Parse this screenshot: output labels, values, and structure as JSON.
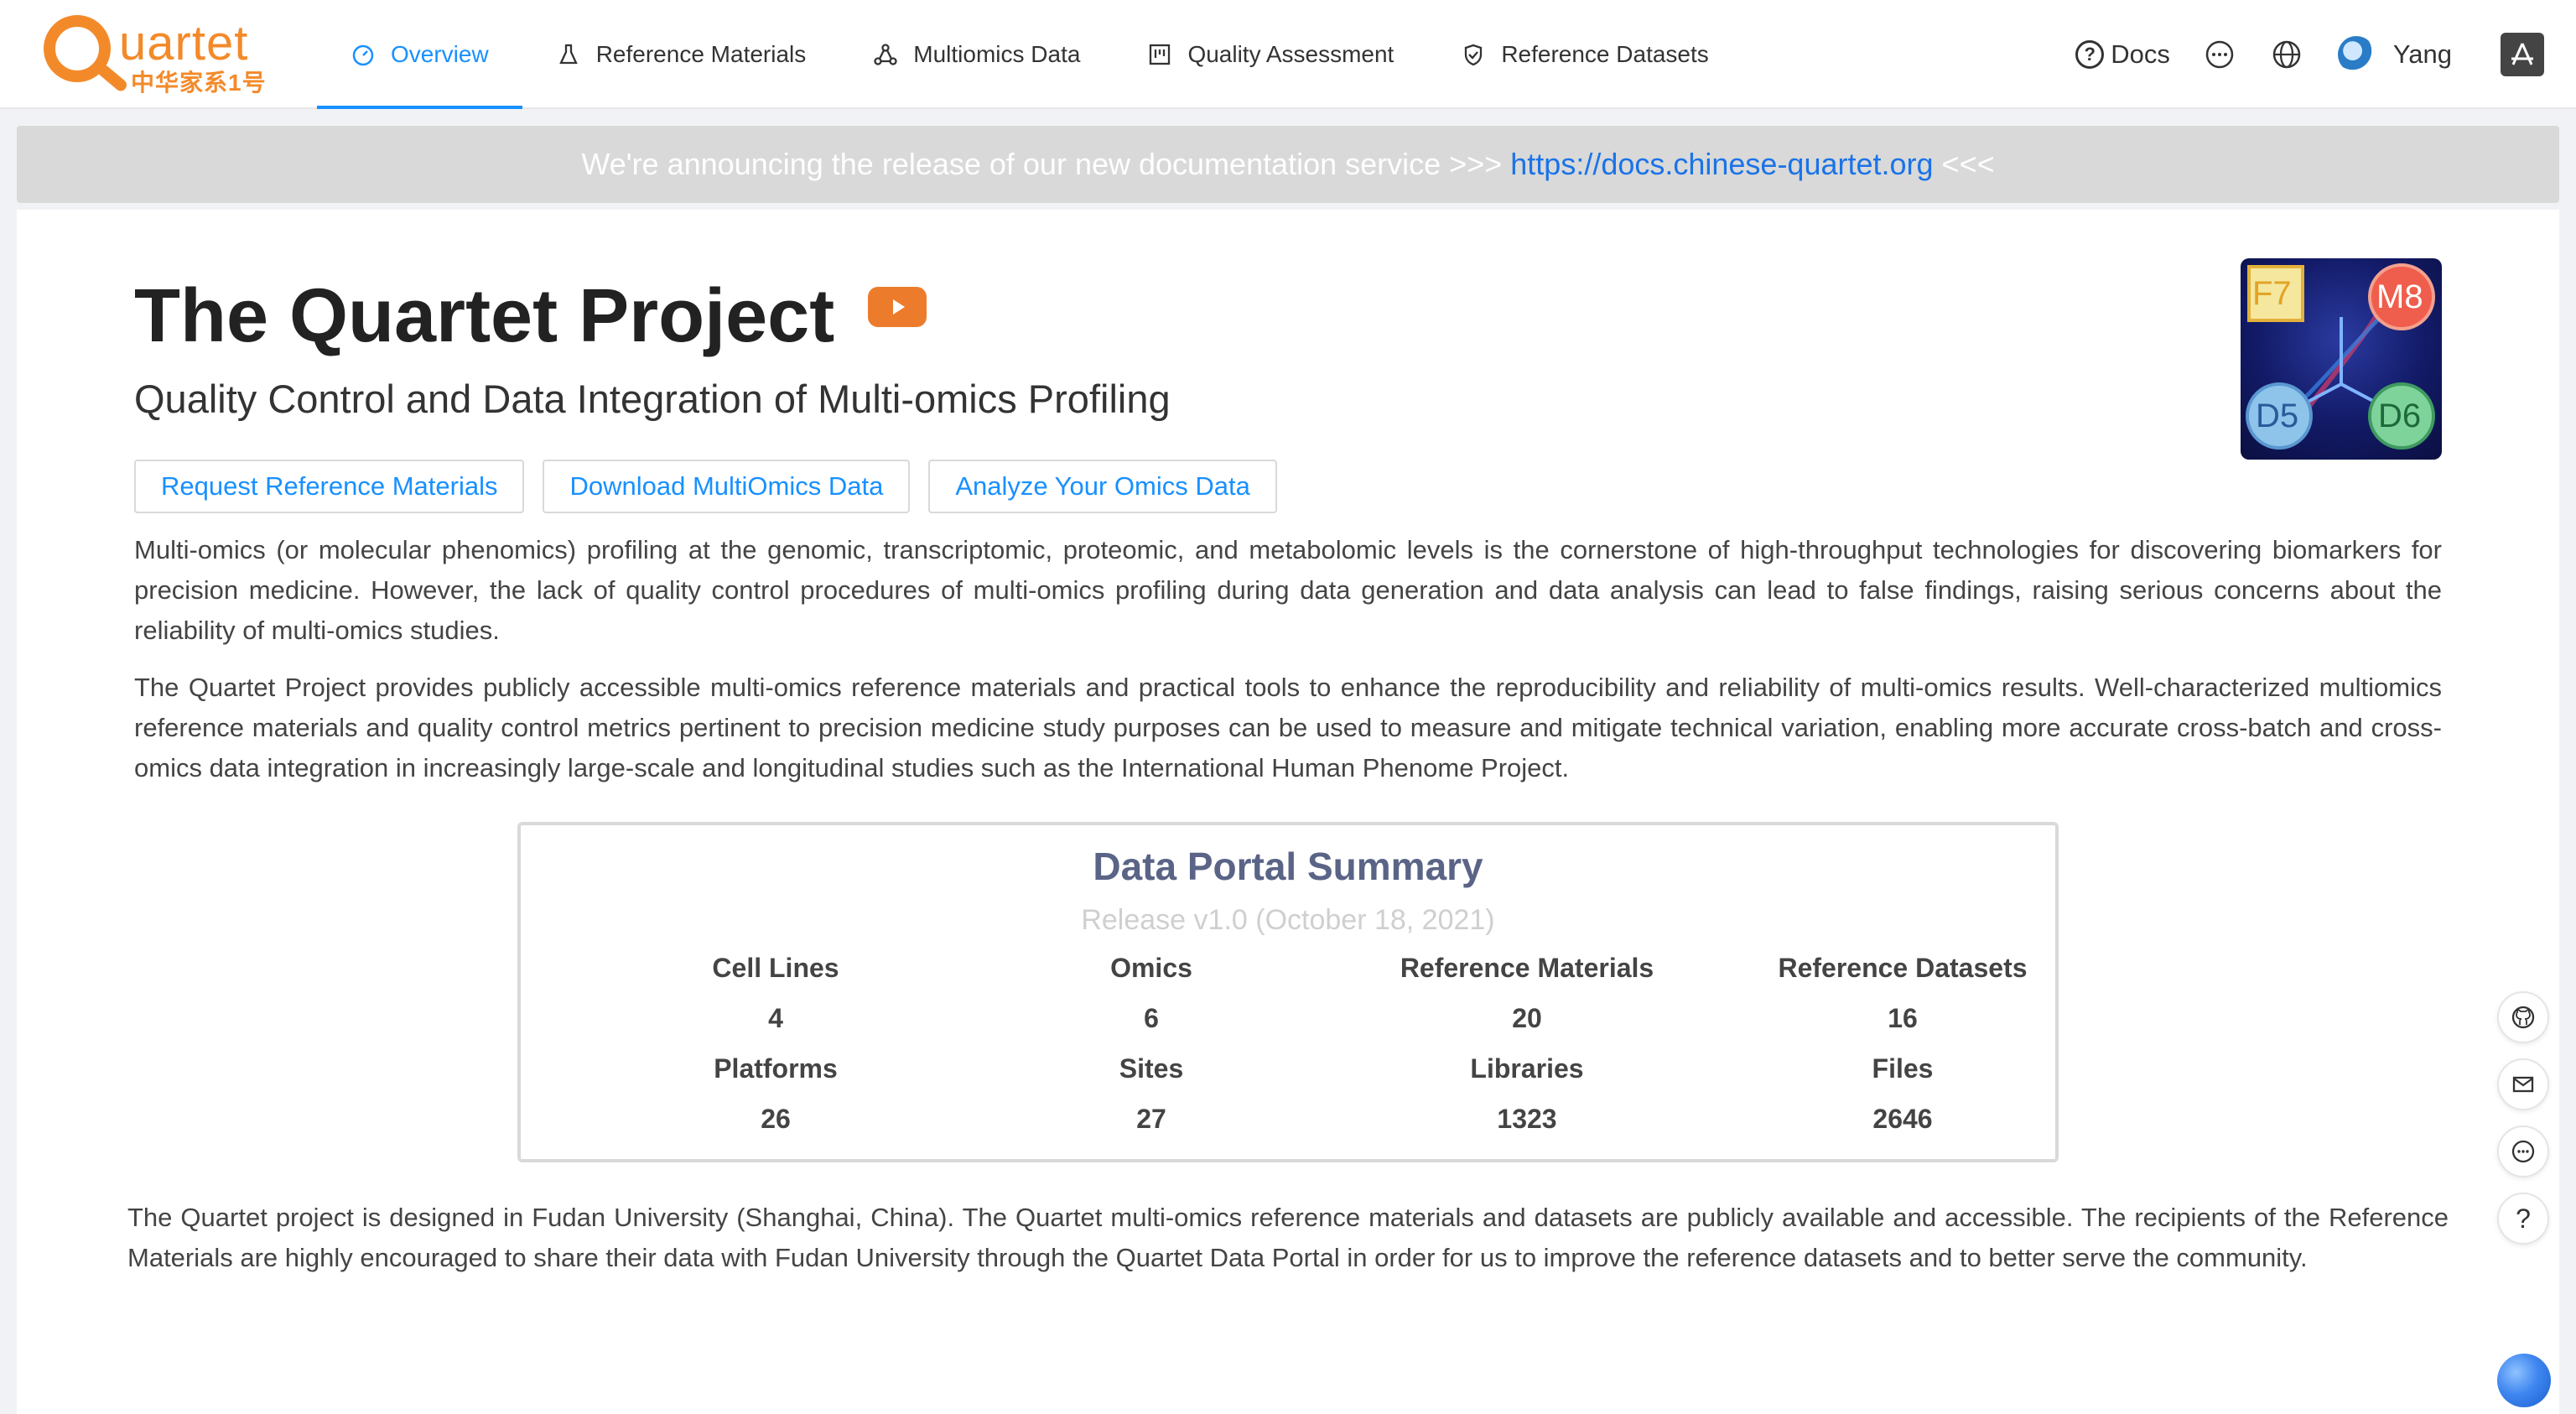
{
  "logo": {
    "word": "uartet",
    "cn": "中华家系1号"
  },
  "nav": [
    {
      "label": "Overview",
      "icon": "dashboard-icon",
      "active": true
    },
    {
      "label": "Reference Materials",
      "icon": "flask-icon",
      "active": false
    },
    {
      "label": "Multiomics Data",
      "icon": "share-nodes-icon",
      "active": false
    },
    {
      "label": "Quality Assessment",
      "icon": "project-board-icon",
      "active": false
    },
    {
      "label": "Reference Datasets",
      "icon": "shield-check-icon",
      "active": false
    }
  ],
  "header_tools": {
    "docs_label": "Docs",
    "user_name": "Yang",
    "icons": [
      "help-circle-icon",
      "chat-icon",
      "globe-icon",
      "app-store-icon"
    ]
  },
  "announcement": {
    "prefix": "We're announcing the release of our new documentation service >>>",
    "link": "https://docs.chinese-quartet.org",
    "suffix": "<<<"
  },
  "hero": {
    "title": "The Quartet Project",
    "subtitle": "Quality Control and Data Integration of Multi-omics Profiling",
    "image_labels": [
      "F7",
      "M8",
      "D5",
      "D6"
    ]
  },
  "buttons": [
    "Request Reference Materials",
    "Download MultiOmics Data",
    "Analyze Your Omics Data"
  ],
  "paragraphs": {
    "p1": "Multi-omics (or molecular phenomics) profiling at the genomic, transcriptomic, proteomic, and metabolomic levels is the cornerstone of high-throughput technologies for discovering biomarkers for precision medicine. However, the lack of quality control procedures of multi-omics profiling during data generation and data analysis can lead to false findings, raising serious concerns about the reliability of multi-omics studies.",
    "p2": "The Quartet Project provides publicly accessible multi-omics reference materials and practical tools to enhance the reproducibility and reliability of multi-omics results. Well-characterized multiomics reference materials and quality control metrics pertinent to precision medicine study purposes can be used to measure and mitigate technical variation, enabling more accurate cross-batch and cross-omics data integration in increasingly large-scale and longitudinal studies such as the International Human Phenome Project.",
    "p3": "The Quartet project is designed in Fudan University (Shanghai, China). The Quartet multi-omics reference materials and datasets are publicly available and accessible. The recipients of the Reference Materials are highly encouraged to share their data with Fudan University through the Quartet Data Portal in order for us to improve the reference datasets and to better serve the community."
  },
  "summary": {
    "title": "Data Portal Summary",
    "release": "Release v1.0 (October 18, 2021)",
    "stats": [
      {
        "label": "Cell Lines",
        "value": "4"
      },
      {
        "label": "Omics",
        "value": "6"
      },
      {
        "label": "Reference Materials",
        "value": "20"
      },
      {
        "label": "Reference Datasets",
        "value": "16"
      },
      {
        "label": "Platforms",
        "value": "26"
      },
      {
        "label": "Sites",
        "value": "27"
      },
      {
        "label": "Libraries",
        "value": "1323"
      },
      {
        "label": "Files",
        "value": "2646"
      }
    ]
  },
  "float_tools": {
    "icons": [
      "github-icon",
      "mail-icon",
      "chat-icon",
      "question-icon"
    ],
    "question_glyph": "?"
  },
  "colors": {
    "brand_orange": "#f38a2a",
    "link_blue": "#1890ff",
    "summary_title": "#5a6486"
  }
}
